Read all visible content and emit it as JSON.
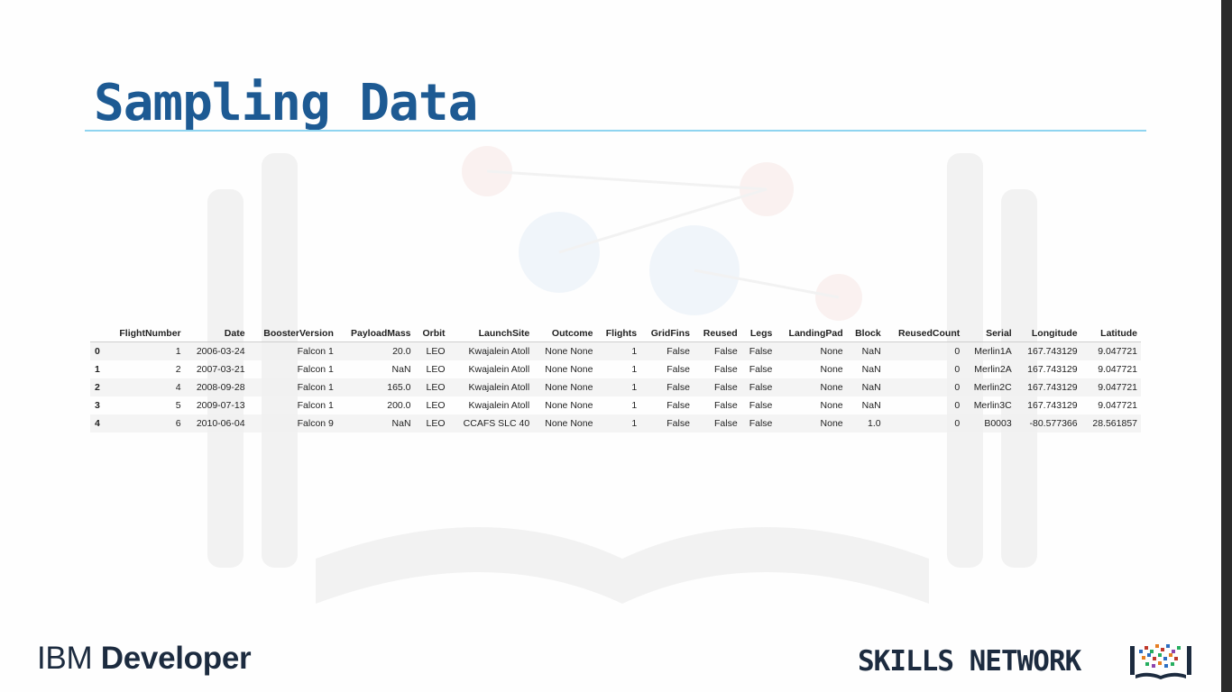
{
  "title": "Sampling Data",
  "colors": {
    "title": "#1d5a93",
    "rule": "#8fd4f0",
    "brand_dark": "#1c2b3f"
  },
  "table": {
    "columns": [
      "FlightNumber",
      "Date",
      "BoosterVersion",
      "PayloadMass",
      "Orbit",
      "LaunchSite",
      "Outcome",
      "Flights",
      "GridFins",
      "Reused",
      "Legs",
      "LandingPad",
      "Block",
      "ReusedCount",
      "Serial",
      "Longitude",
      "Latitude"
    ],
    "rows": [
      {
        "index": "0",
        "cells": [
          "1",
          "2006-03-24",
          "Falcon 1",
          "20.0",
          "LEO",
          "Kwajalein Atoll",
          "None None",
          "1",
          "False",
          "False",
          "False",
          "None",
          "NaN",
          "0",
          "Merlin1A",
          "167.743129",
          "9.047721"
        ]
      },
      {
        "index": "1",
        "cells": [
          "2",
          "2007-03-21",
          "Falcon 1",
          "NaN",
          "LEO",
          "Kwajalein Atoll",
          "None None",
          "1",
          "False",
          "False",
          "False",
          "None",
          "NaN",
          "0",
          "Merlin2A",
          "167.743129",
          "9.047721"
        ]
      },
      {
        "index": "2",
        "cells": [
          "4",
          "2008-09-28",
          "Falcon 1",
          "165.0",
          "LEO",
          "Kwajalein Atoll",
          "None None",
          "1",
          "False",
          "False",
          "False",
          "None",
          "NaN",
          "0",
          "Merlin2C",
          "167.743129",
          "9.047721"
        ]
      },
      {
        "index": "3",
        "cells": [
          "5",
          "2009-07-13",
          "Falcon 1",
          "200.0",
          "LEO",
          "Kwajalein Atoll",
          "None None",
          "1",
          "False",
          "False",
          "False",
          "None",
          "NaN",
          "0",
          "Merlin3C",
          "167.743129",
          "9.047721"
        ]
      },
      {
        "index": "4",
        "cells": [
          "6",
          "2010-06-04",
          "Falcon 9",
          "NaN",
          "LEO",
          "CCAFS SLC 40",
          "None None",
          "1",
          "False",
          "False",
          "False",
          "None",
          "1.0",
          "0",
          "B0003",
          "-80.577366",
          "28.561857"
        ]
      }
    ]
  },
  "footer": {
    "ibm": "IBM",
    "developer": "Developer",
    "skills_network": "SKILLS NETWORK",
    "icon": "skills-network-book-icon"
  }
}
